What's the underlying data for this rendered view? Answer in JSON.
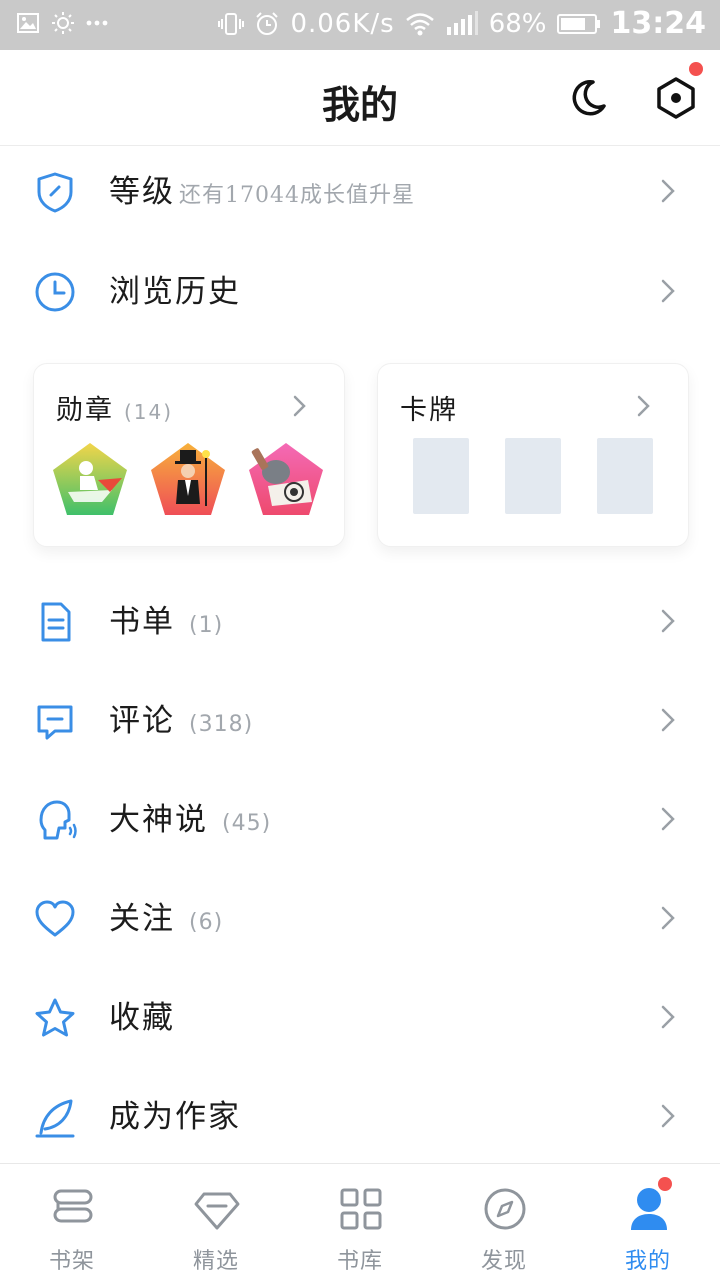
{
  "status_bar": {
    "speed": "0.06K/s",
    "battery": "68%",
    "time": "13:24"
  },
  "header": {
    "title": "我的"
  },
  "level_row": {
    "label": "等级",
    "sub": "还有17044成长值升星"
  },
  "history_row": {
    "label": "浏览历史"
  },
  "medals_card": {
    "title": "勋章",
    "count": "(14)"
  },
  "cards_card": {
    "title": "卡牌"
  },
  "menu": [
    {
      "label": "书单",
      "count": "(1)",
      "icon": "document-icon"
    },
    {
      "label": "评论",
      "count": "(318)",
      "icon": "comment-icon"
    },
    {
      "label": "大神说",
      "count": "(45)",
      "icon": "speaking-head-icon"
    },
    {
      "label": "关注",
      "count": "(6)",
      "icon": "heart-icon"
    },
    {
      "label": "收藏",
      "count": "",
      "icon": "star-icon"
    },
    {
      "label": "成为作家",
      "count": "",
      "icon": "feather-pen-icon"
    }
  ],
  "tabs": [
    {
      "label": "书架",
      "icon": "bookshelf-icon"
    },
    {
      "label": "精选",
      "icon": "diamond-icon"
    },
    {
      "label": "书库",
      "icon": "grid-icon"
    },
    {
      "label": "发现",
      "icon": "compass-icon"
    },
    {
      "label": "我的",
      "icon": "user-icon",
      "active": true
    }
  ],
  "colors": {
    "accent_blue": "#3a8ee6",
    "active_tab": "#2f8cf0",
    "badge_red": "#f4514f",
    "muted_text": "#a2a7ad",
    "status_bar_bg": "#c9c9c9"
  }
}
